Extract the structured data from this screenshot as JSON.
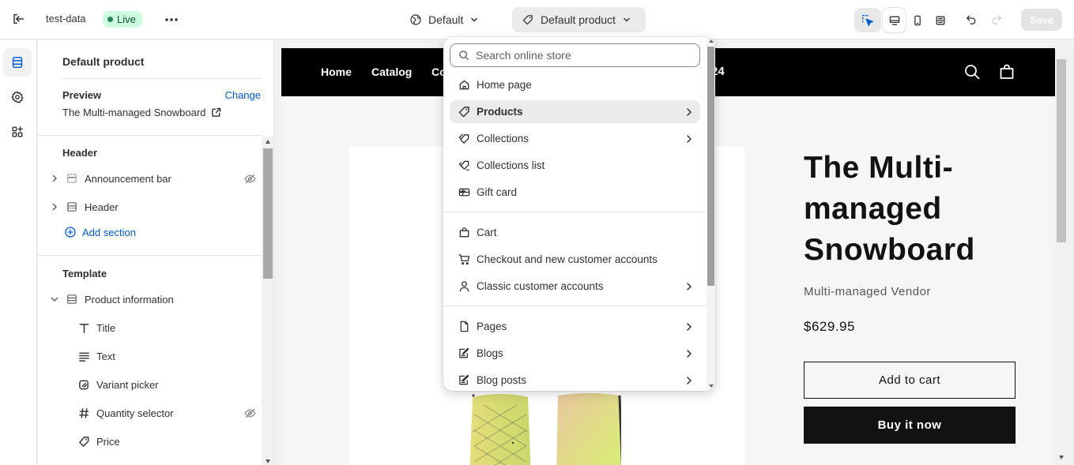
{
  "topbar": {
    "store_name": "test-data",
    "status_badge": "Live",
    "theme_selector": "Default",
    "page_selector": "Default product",
    "save_label": "Save"
  },
  "sidebar": {
    "title": "Default product",
    "preview_label": "Preview",
    "change_link": "Change",
    "preview_product": "The Multi-managed Snowboard",
    "header_group": {
      "title": "Header",
      "items": [
        {
          "label": "Announcement bar",
          "hidden": true
        },
        {
          "label": "Header",
          "hidden": false
        }
      ],
      "add_section": "Add section"
    },
    "template_group": {
      "title": "Template",
      "section": "Product information",
      "blocks": [
        {
          "label": "Title",
          "icon": "title-icon",
          "hidden": false
        },
        {
          "label": "Text",
          "icon": "text-icon",
          "hidden": false
        },
        {
          "label": "Variant picker",
          "icon": "variant-icon",
          "hidden": false
        },
        {
          "label": "Quantity selector",
          "icon": "hash-icon",
          "hidden": true
        },
        {
          "label": "Price",
          "icon": "price-tag-icon",
          "hidden": false
        }
      ]
    }
  },
  "dropdown": {
    "search_placeholder": "Search online store",
    "groups": [
      [
        {
          "label": "Home page",
          "icon": "home-icon",
          "has_submenu": false,
          "active": false
        },
        {
          "label": "Products",
          "icon": "tag-icon",
          "has_submenu": true,
          "active": true
        },
        {
          "label": "Collections",
          "icon": "collection-icon",
          "has_submenu": true,
          "active": false
        },
        {
          "label": "Collections list",
          "icon": "collection-list-icon",
          "has_submenu": false,
          "active": false
        },
        {
          "label": "Gift card",
          "icon": "gift-card-icon",
          "has_submenu": false,
          "active": false
        }
      ],
      [
        {
          "label": "Cart",
          "icon": "bag-icon",
          "has_submenu": false,
          "active": false
        },
        {
          "label": "Checkout and new customer accounts",
          "icon": "cart-icon",
          "has_submenu": false,
          "active": false
        },
        {
          "label": "Classic customer accounts",
          "icon": "person-icon",
          "has_submenu": true,
          "active": false
        }
      ],
      [
        {
          "label": "Pages",
          "icon": "page-icon",
          "has_submenu": true,
          "active": false
        },
        {
          "label": "Blogs",
          "icon": "blog-icon",
          "has_submenu": true,
          "active": false
        },
        {
          "label": "Blog posts",
          "icon": "blog-post-icon",
          "has_submenu": true,
          "active": false
        }
      ]
    ]
  },
  "storefront": {
    "nav": [
      "Home",
      "Catalog",
      "Co"
    ],
    "nav_tail": "24",
    "product_title": "The Multi-managed Snowboard",
    "vendor": "Multi-managed Vendor",
    "price": "$629.95",
    "add_to_cart": "Add to cart",
    "buy_now": "Buy it now"
  },
  "colors": {
    "accent": "#005bd3",
    "live_badge_bg": "#cdfee1",
    "live_badge_text": "#0c5132",
    "store_header": "#000000"
  }
}
